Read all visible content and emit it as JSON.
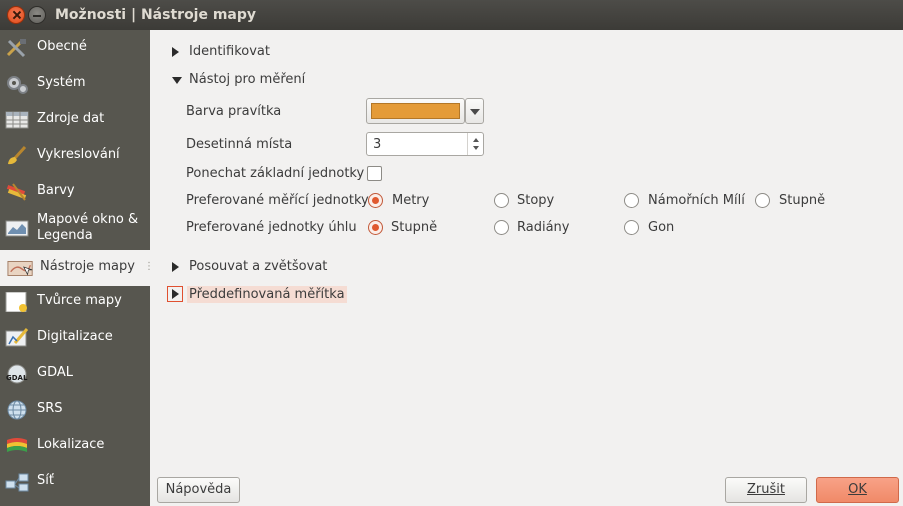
{
  "window": {
    "title": "Možnosti | Nástroje mapy"
  },
  "sidebar": {
    "items": [
      {
        "label": "Obecné"
      },
      {
        "label": "Systém"
      },
      {
        "label": "Zdroje dat"
      },
      {
        "label": "Vykreslování"
      },
      {
        "label": "Barvy"
      },
      {
        "label": "Mapové okno &\nLegenda",
        "line1": "Mapové okno &",
        "line2": "Legenda"
      },
      {
        "label": "Nástroje mapy"
      },
      {
        "label": "Tvůrce mapy"
      },
      {
        "label": "Digitalizace"
      },
      {
        "label": "GDAL"
      },
      {
        "label": "SRS"
      },
      {
        "label": "Lokalizace"
      },
      {
        "label": "Síť"
      }
    ],
    "active": "Nástroje mapy"
  },
  "sections": {
    "identify": "Identifikovat",
    "measure": "Nástoj pro měření",
    "pan_zoom": "Posouvat a zvětšovat",
    "scales": "Předdefinovaná měřítka"
  },
  "measure": {
    "ruler_color_label": "Barva pravítka",
    "ruler_color": "#e49b38",
    "decimals_label": "Desetinná místa",
    "decimals_value": "3",
    "keep_base_label": "Ponechat základní jednotky",
    "keep_base_checked": false,
    "units_label": "Preferované měřící jednotky",
    "units_options": [
      "Metry",
      "Stopy",
      "Námořních Mílí",
      "Stupně"
    ],
    "units_selected": "Metry",
    "angle_label": "Preferované jednotky úhlu",
    "angle_options": [
      "Stupně",
      "Radiány",
      "Gon"
    ],
    "angle_selected": "Stupně"
  },
  "buttons": {
    "help": "Nápověda",
    "cancel": "Zrušit",
    "ok": "OK"
  },
  "colors": {
    "accent": "#e0592f",
    "sidebar_bg": "#57564f",
    "ok_button": "#f08a68"
  }
}
